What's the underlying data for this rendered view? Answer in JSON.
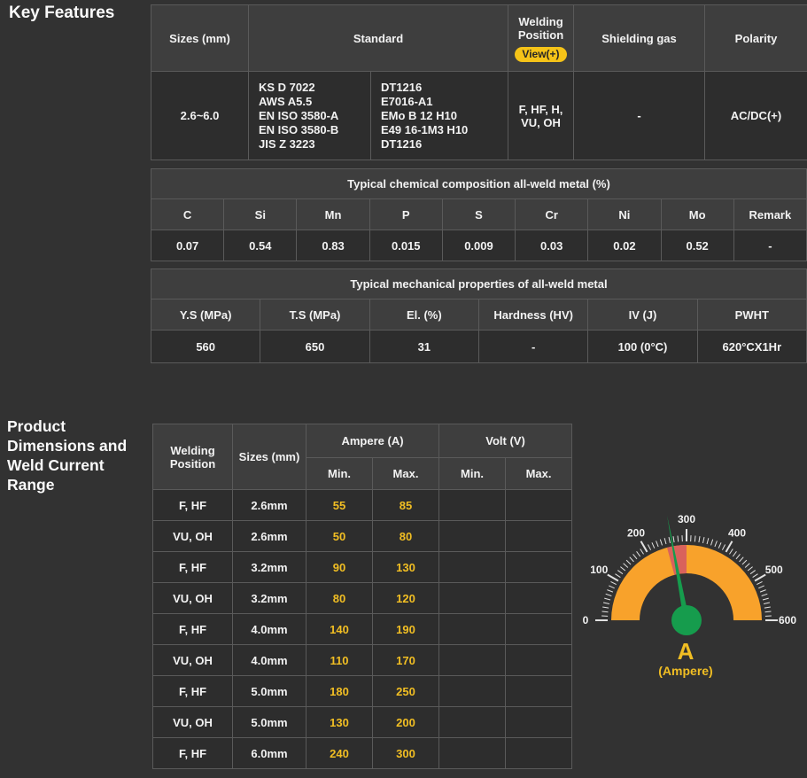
{
  "headings": {
    "key_features": "Key Features",
    "product_dims": "Product Dimensions and Weld Current Range"
  },
  "colors": {
    "page_bg": "#323232",
    "header_cell": "#3e3e3e",
    "body_cell": "#2d2d2d",
    "border": "#5a5a5a",
    "accent_yellow": "#f1be23",
    "view_btn_bg": "#f5c318",
    "gauge_band": "#f8a22b",
    "gauge_zone": "#d9625c",
    "gauge_needle": "#169c4d"
  },
  "spec_table": {
    "headers": {
      "sizes": "Sizes (mm)",
      "standard": "Standard",
      "welding_position": "Welding Position",
      "view_button": "View(+)",
      "shielding_gas": "Shielding gas",
      "polarity": "Polarity"
    },
    "row": {
      "sizes": "2.6~6.0",
      "standard_left": [
        "KS D 7022",
        "AWS A5.5",
        "EN ISO 3580-A",
        "EN ISO 3580-B",
        "JIS Z 3223"
      ],
      "standard_right": [
        "DT1216",
        "E7016-A1",
        "EMo B 12 H10",
        "E49 16-1M3 H10",
        "DT1216"
      ],
      "welding_position": "F, HF, H, VU, OH",
      "shielding_gas": "-",
      "polarity": "AC/DC(+)"
    }
  },
  "chemical_table": {
    "title": "Typical chemical composition all-weld metal (%)",
    "headers": [
      "C",
      "Si",
      "Mn",
      "P",
      "S",
      "Cr",
      "Ni",
      "Mo",
      "Remark"
    ],
    "values": [
      "0.07",
      "0.54",
      "0.83",
      "0.015",
      "0.009",
      "0.03",
      "0.02",
      "0.52",
      "-"
    ]
  },
  "mechanical_table": {
    "title": "Typical mechanical properties of all-weld metal",
    "headers": [
      "Y.S (MPa)",
      "T.S (MPa)",
      "El. (%)",
      "Hardness (HV)",
      "IV (J)",
      "PWHT"
    ],
    "values": [
      "560",
      "650",
      "31",
      "-",
      "100 (0°C)",
      "620°CX1Hr"
    ]
  },
  "current_table": {
    "headers": {
      "welding_position": "Welding Position",
      "sizes": "Sizes (mm)",
      "ampere": "Ampere (A)",
      "volt": "Volt (V)",
      "min": "Min.",
      "max": "Max."
    },
    "rows": [
      {
        "pos": "F, HF",
        "size": "2.6mm",
        "amp_min": "55",
        "amp_max": "85",
        "volt_min": "",
        "volt_max": ""
      },
      {
        "pos": "VU, OH",
        "size": "2.6mm",
        "amp_min": "50",
        "amp_max": "80",
        "volt_min": "",
        "volt_max": ""
      },
      {
        "pos": "F, HF",
        "size": "3.2mm",
        "amp_min": "90",
        "amp_max": "130",
        "volt_min": "",
        "volt_max": ""
      },
      {
        "pos": "VU, OH",
        "size": "3.2mm",
        "amp_min": "80",
        "amp_max": "120",
        "volt_min": "",
        "volt_max": ""
      },
      {
        "pos": "F, HF",
        "size": "4.0mm",
        "amp_min": "140",
        "amp_max": "190",
        "volt_min": "",
        "volt_max": ""
      },
      {
        "pos": "VU, OH",
        "size": "4.0mm",
        "amp_min": "110",
        "amp_max": "170",
        "volt_min": "",
        "volt_max": ""
      },
      {
        "pos": "F, HF",
        "size": "5.0mm",
        "amp_min": "180",
        "amp_max": "250",
        "volt_min": "",
        "volt_max": ""
      },
      {
        "pos": "VU, OH",
        "size": "5.0mm",
        "amp_min": "130",
        "amp_max": "200",
        "volt_min": "",
        "volt_max": ""
      },
      {
        "pos": "F, HF",
        "size": "6.0mm",
        "amp_min": "240",
        "amp_max": "300",
        "volt_min": "",
        "volt_max": ""
      }
    ]
  },
  "chart_data": {
    "type": "gauge",
    "title": "Weld current range gauge",
    "min": 0,
    "max": 600,
    "major_tick_step": 100,
    "minor_tick_step": 10,
    "tick_labels": [
      0,
      100,
      200,
      300,
      400,
      500,
      600
    ],
    "band_color": "#f8a22b",
    "highlight_zone": {
      "from": 250,
      "to": 300,
      "color": "#d9625c"
    },
    "needle_value": 265,
    "needle_color": "#169c4d",
    "unit": "A",
    "unit_label": "(Ampere)"
  }
}
